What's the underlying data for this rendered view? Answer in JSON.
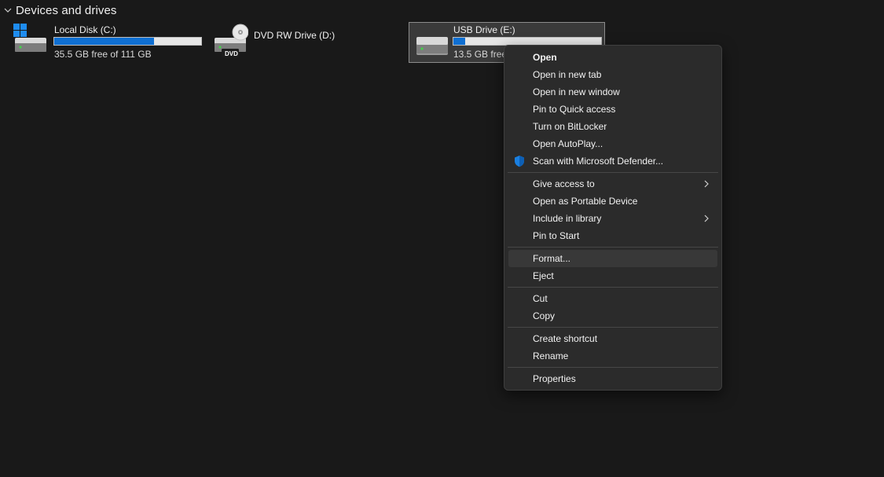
{
  "section": {
    "title": "Devices and drives"
  },
  "drives": [
    {
      "name": "Local Disk (C:)",
      "free_text": "35.5 GB free of 111 GB",
      "used_fraction": 0.68,
      "icon": "windows-drive-icon"
    },
    {
      "name": "DVD RW Drive (D:)",
      "icon": "dvd-drive-icon",
      "badge": "DVD"
    },
    {
      "name": "USB Drive (E:)",
      "free_text": "13.5 GB free",
      "used_fraction": 0.08,
      "icon": "usb-drive-icon",
      "selected": true
    }
  ],
  "context_menu": {
    "groups": [
      [
        {
          "label": "Open",
          "bold": true
        },
        {
          "label": "Open in new tab"
        },
        {
          "label": "Open in new window"
        },
        {
          "label": "Pin to Quick access"
        },
        {
          "label": "Turn on BitLocker"
        },
        {
          "label": "Open AutoPlay..."
        },
        {
          "label": "Scan with Microsoft Defender...",
          "icon": "defender-shield-icon"
        }
      ],
      [
        {
          "label": "Give access to",
          "submenu": true
        },
        {
          "label": "Open as Portable Device"
        },
        {
          "label": "Include in library",
          "submenu": true
        },
        {
          "label": "Pin to Start"
        }
      ],
      [
        {
          "label": "Format...",
          "hover": true
        },
        {
          "label": "Eject"
        }
      ],
      [
        {
          "label": "Cut"
        },
        {
          "label": "Copy"
        }
      ],
      [
        {
          "label": "Create shortcut"
        },
        {
          "label": "Rename"
        }
      ],
      [
        {
          "label": "Properties"
        }
      ]
    ]
  },
  "colors": {
    "background": "#191919",
    "menu_background": "#2b2b2b",
    "capacity_bar_fill": "#0f6fd2",
    "defender_blue": "#1a7fe0"
  }
}
